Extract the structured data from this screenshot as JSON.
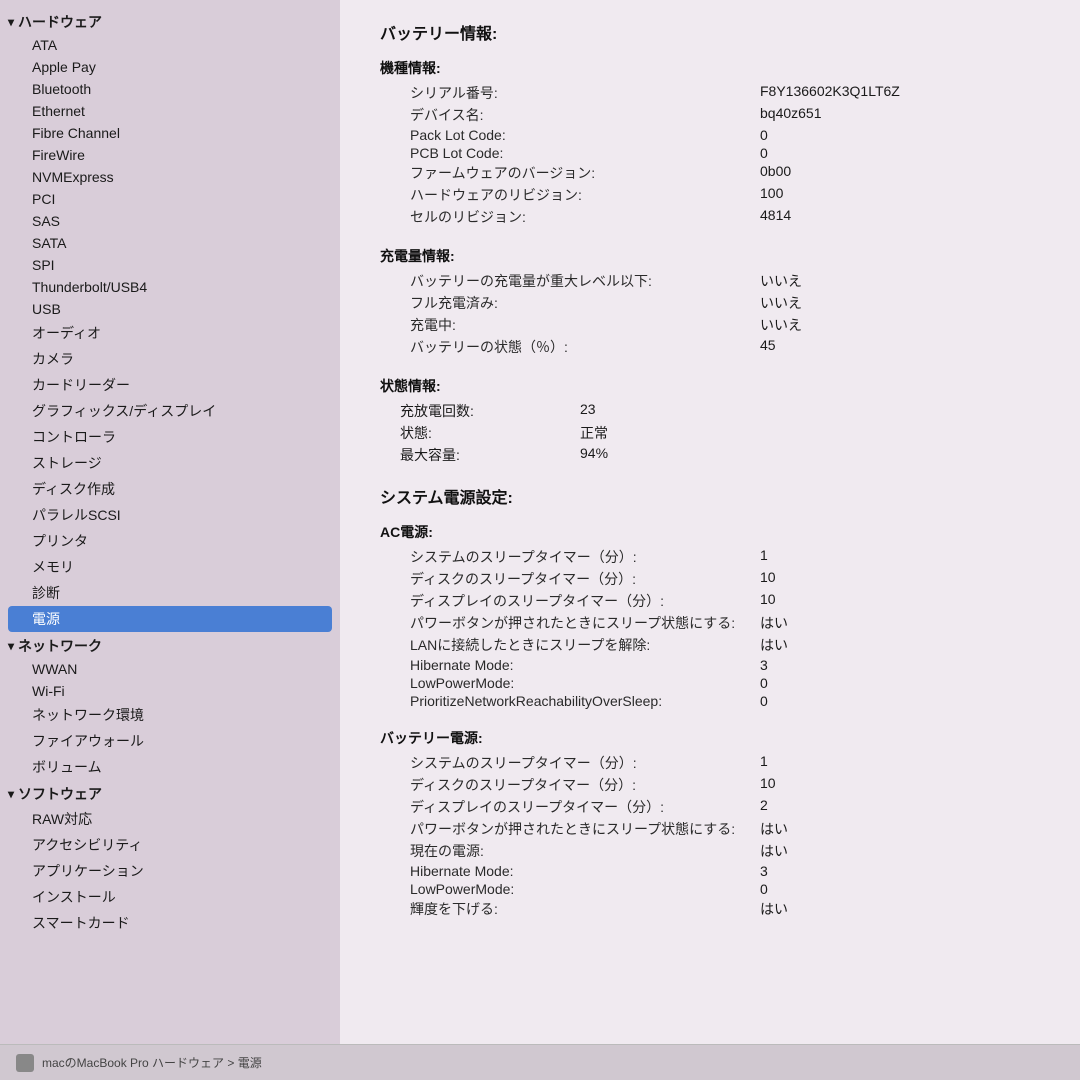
{
  "sidebar": {
    "hardware_section": "ハードウェア",
    "hardware_items": [
      "ATA",
      "Apple Pay",
      "Bluetooth",
      "Ethernet",
      "Fibre Channel",
      "FireWire",
      "NVMExpress",
      "PCI",
      "SAS",
      "SATA",
      "SPI",
      "Thunderbolt/USB4",
      "USB",
      "オーディオ",
      "カメラ",
      "カードリーダー",
      "グラフィックス/ディスプレイ",
      "コントローラ",
      "ストレージ",
      "ディスク作成",
      "パラレルSCSI",
      "プリンタ",
      "メモリ",
      "診断",
      "電源"
    ],
    "network_section": "ネットワーク",
    "network_items": [
      "WWAN",
      "Wi-Fi",
      "ネットワーク環境",
      "ファイアウォール",
      "ボリューム"
    ],
    "software_section": "ソフトウェア",
    "software_items": [
      "RAW対応",
      "アクセシビリティ",
      "アプリケーション",
      "インストール",
      "スマートカード"
    ]
  },
  "main": {
    "page_title": "バッテリー情報:",
    "machine_info_title": "機種情報:",
    "serial_label": "シリアル番号:",
    "serial_value": "F8Y136602K3Q1LT6Z",
    "device_label": "デバイス名:",
    "device_value": "bq40z651",
    "pack_lot_label": "Pack Lot Code:",
    "pack_lot_value": "0",
    "pcb_lot_label": "PCB Lot Code:",
    "pcb_lot_value": "0",
    "firmware_label": "ファームウェアのバージョン:",
    "firmware_value": "0b00",
    "hardware_rev_label": "ハードウェアのリビジョン:",
    "hardware_rev_value": "100",
    "cell_rev_label": "セルのリビジョン:",
    "cell_rev_value": "4814",
    "charge_info_title": "充電量情報:",
    "critical_label": "バッテリーの充電量が重大レベル以下:",
    "critical_value": "いいえ",
    "fully_charged_label": "フル充電済み:",
    "fully_charged_value": "いいえ",
    "charging_label": "充電中:",
    "charging_value": "いいえ",
    "battery_status_label": "バッテリーの状態（％）:",
    "battery_status_value": "45",
    "status_info_title": "状態情報:",
    "cycle_label": "充放電回数:",
    "cycle_value": "23",
    "condition_label": "状態:",
    "condition_value": "正常",
    "max_capacity_label": "最大容量:",
    "max_capacity_value": "94%",
    "system_power_title": "システム電源設定:",
    "ac_power_title": "AC電源:",
    "ac_sleep_timer_label": "システムのスリープタイマー（分）:",
    "ac_sleep_timer_value": "1",
    "ac_disk_sleep_label": "ディスクのスリープタイマー（分）:",
    "ac_disk_sleep_value": "10",
    "ac_display_sleep_label": "ディスプレイのスリープタイマー（分）:",
    "ac_display_sleep_value": "10",
    "ac_power_button_label": "パワーボタンが押されたときにスリープ状態にする:",
    "ac_power_button_value": "はい",
    "ac_lan_label": "LANに接続したときにスリープを解除:",
    "ac_lan_value": "はい",
    "ac_hibernate_label": "Hibernate Mode:",
    "ac_hibernate_value": "3",
    "ac_lowpower_label": "LowPowerMode:",
    "ac_lowpower_value": "0",
    "ac_prioritize_label": "PrioritizeNetworkReachabilityOverSleep:",
    "ac_prioritize_value": "0",
    "battery_power_title": "バッテリー電源:",
    "bat_sleep_timer_label": "システムのスリープタイマー（分）:",
    "bat_sleep_timer_value": "1",
    "bat_disk_sleep_label": "ディスクのスリープタイマー（分）:",
    "bat_disk_sleep_value": "10",
    "bat_display_sleep_label": "ディスプレイのスリープタイマー（分）:",
    "bat_display_sleep_value": "2",
    "bat_power_button_label": "パワーボタンが押されたときにスリープ状態にする:",
    "bat_power_button_value": "はい",
    "bat_current_power_label": "現在の電源:",
    "bat_current_power_value": "はい",
    "bat_hibernate_label": "Hibernate Mode:",
    "bat_hibernate_value": "3",
    "bat_lowpower_label": "LowPowerMode:",
    "bat_lowpower_value": "0",
    "bat_brightness_label": "輝度を下げる:",
    "bat_brightness_value": "はい"
  },
  "bottom_bar": {
    "text": "macのMacBook Pro ハードウェア > 電源"
  }
}
